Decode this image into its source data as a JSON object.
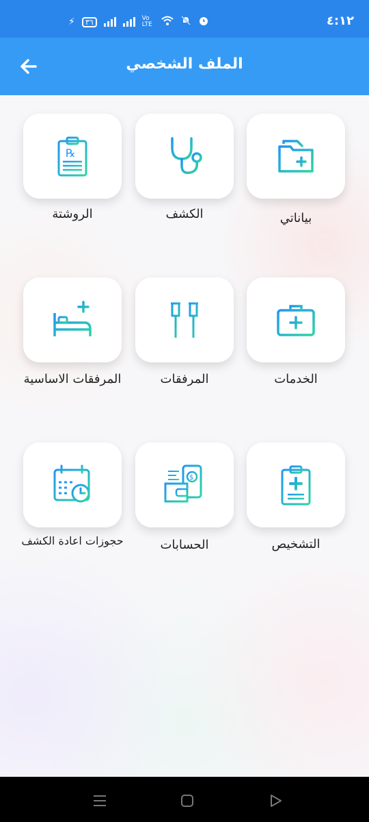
{
  "status": {
    "time": "٤:١٢",
    "battery": "٣٦",
    "volte": "Vo LTE"
  },
  "appbar": {
    "title": "الملف الشخصي"
  },
  "menu": [
    {
      "label": "بياناتي",
      "icon": "folder-plus-icon"
    },
    {
      "label": "الكشف",
      "icon": "stethoscope-icon"
    },
    {
      "label": "الروشتة",
      "icon": "prescription-icon"
    },
    {
      "label": "الخدمات",
      "icon": "medical-kit-icon"
    },
    {
      "label": "المرفقات",
      "icon": "crutches-icon"
    },
    {
      "label": "المرفقات الاساسية",
      "icon": "hospital-bed-icon"
    },
    {
      "label": "التشخيص",
      "icon": "clipboard-cross-icon"
    },
    {
      "label": "الحسابات",
      "icon": "wallet-phone-icon"
    },
    {
      "label": "حجوزات اعادة الكشف",
      "icon": "calendar-clock-icon"
    }
  ],
  "colors": {
    "statusbar": "#2b86ec",
    "appbar": "#359bf4",
    "icon_start": "#2196f3",
    "icon_end": "#2ed3a4"
  }
}
